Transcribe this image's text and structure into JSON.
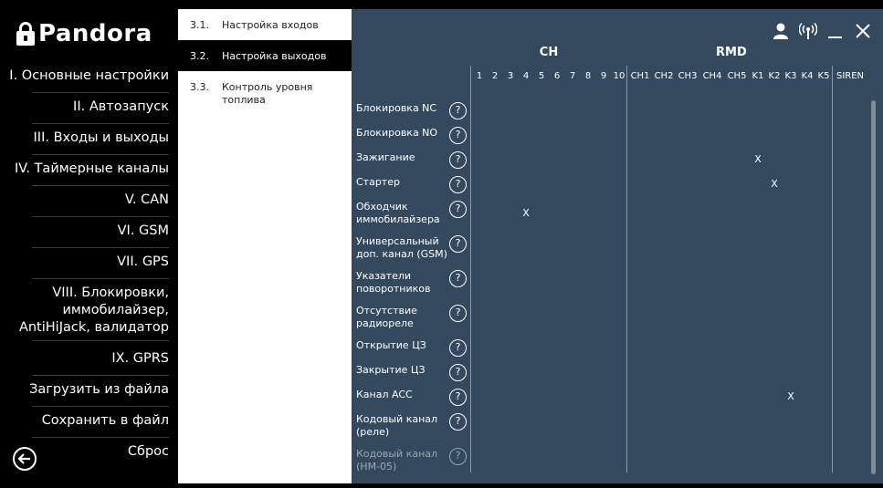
{
  "app": {
    "logo_text": "Pandora"
  },
  "sidebar": {
    "items": [
      {
        "label": "I. Основные настройки"
      },
      {
        "label": "II. Автозапуск"
      },
      {
        "label": "III. Входы и выходы"
      },
      {
        "label": "IV. Таймерные каналы"
      },
      {
        "label": "V. CAN"
      },
      {
        "label": "VI. GSM"
      },
      {
        "label": "VII. GPS"
      },
      {
        "label": "VIII. Блокировки, иммобилайзер, AntiHiJack, валидатор"
      },
      {
        "label": "IX. GPRS"
      },
      {
        "label": "Загрузить из файла"
      },
      {
        "label": "Сохранить в файл"
      },
      {
        "label": "Сброс"
      }
    ]
  },
  "submenu": {
    "items": [
      {
        "num": "3.1.",
        "label": "Настройка входов",
        "active": false
      },
      {
        "num": "3.2.",
        "label": "Настройка выходов",
        "active": true
      },
      {
        "num": "3.3.",
        "label": "Контроль уровня топлива",
        "active": false
      }
    ]
  },
  "grid": {
    "groups": [
      {
        "label": "CH"
      },
      {
        "label": "RMD"
      }
    ],
    "columns": [
      "1",
      "2",
      "3",
      "4",
      "5",
      "6",
      "7",
      "8",
      "9",
      "10",
      "CH1",
      "CH2",
      "CH3",
      "CH4",
      "CH5",
      "K1",
      "K2",
      "K3",
      "K4",
      "K5",
      "SIREN"
    ],
    "help_glyph": "?",
    "mark_glyph": "X",
    "rows": [
      {
        "label": "Блокировка NC",
        "mark": null,
        "dim": false
      },
      {
        "label": "Блокировка NO",
        "mark": null,
        "dim": false
      },
      {
        "label": "Зажигание",
        "mark": "K1",
        "dim": false
      },
      {
        "label": "Стартер",
        "mark": "K2",
        "dim": false
      },
      {
        "label": "Обходчик иммобилайзера",
        "mark": "4",
        "dim": false
      },
      {
        "label": "Универсальный доп. канал (GSM)",
        "mark": null,
        "dim": false
      },
      {
        "label": "Указатели поворотников",
        "mark": null,
        "dim": false
      },
      {
        "label": "Отсутствие радиореле",
        "mark": null,
        "dim": false
      },
      {
        "label": "Открытие ЦЗ",
        "mark": null,
        "dim": false
      },
      {
        "label": "Закрытие ЦЗ",
        "mark": null,
        "dim": false
      },
      {
        "label": "Канал ACC",
        "mark": "K3",
        "dim": false
      },
      {
        "label": "Кодовый канал (реле)",
        "mark": null,
        "dim": false
      },
      {
        "label": "Кодовый канал (HM-05)",
        "mark": null,
        "dim": true
      }
    ]
  },
  "icons": {
    "logo": "lock-icon",
    "back": "back-arrow-icon",
    "user": "user-icon",
    "connection": "signal-icon",
    "minimize": "minimize-icon",
    "close": "close-icon"
  }
}
